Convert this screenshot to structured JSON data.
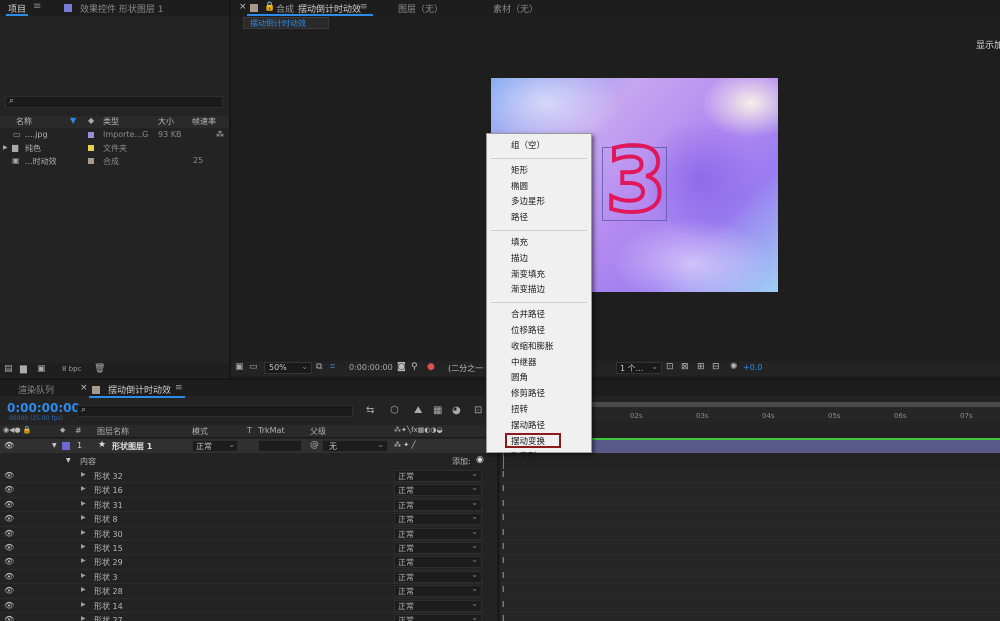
{
  "project_panel": {
    "tab_label": "项目",
    "effect_tab_label": "效果控件 形状图层 1",
    "search_placeholder": "",
    "columns": {
      "name": "名称",
      "type": "类型",
      "size": "大小",
      "framerate": "帧速率"
    },
    "items": [
      {
        "name": "....jpg",
        "type": "Importe...G",
        "size": "93 KB",
        "framerate": "",
        "color": "#9b8ed6"
      },
      {
        "name": "纯色",
        "type": "文件夹",
        "size": "",
        "framerate": "",
        "color": "#e6cf52"
      },
      {
        "name": "...时动效",
        "type": "合成",
        "size": "",
        "framerate": "25",
        "color": "#a89a8a"
      }
    ],
    "bpc_label": "8 bpc"
  },
  "comp_viewer": {
    "tab_prefix": "合成",
    "comp_name": "摆动倒计时动效",
    "layer_tab": "图层（无）",
    "footage_tab": "素材（无）",
    "sub_tab": "摆动倒计时动效",
    "show_label": "显示加",
    "zoom": "50%",
    "timecode": "0:00:00:00",
    "resolution": "(二分之一",
    "views": "1 个...",
    "exposure": "+0.0",
    "digit": "3"
  },
  "context_menu": {
    "items": [
      {
        "label": "组（空）",
        "group": 0
      },
      {
        "label": "矩形",
        "group": 1
      },
      {
        "label": "椭圆",
        "group": 1
      },
      {
        "label": "多边星形",
        "group": 1
      },
      {
        "label": "路径",
        "group": 1
      },
      {
        "label": "填充",
        "group": 2
      },
      {
        "label": "描边",
        "group": 2
      },
      {
        "label": "渐变填充",
        "group": 2
      },
      {
        "label": "渐变描边",
        "group": 2
      },
      {
        "label": "合并路径",
        "group": 3
      },
      {
        "label": "位移路径",
        "group": 3
      },
      {
        "label": "收缩和膨胀",
        "group": 3
      },
      {
        "label": "中继器",
        "group": 3
      },
      {
        "label": "圆角",
        "group": 3
      },
      {
        "label": "修剪路径",
        "group": 3
      },
      {
        "label": "扭转",
        "group": 3
      },
      {
        "label": "摆动路径",
        "group": 3
      },
      {
        "label": "摆动变换",
        "group": 3,
        "highlighted": true
      },
      {
        "label": "Z 字形",
        "group": 3
      }
    ],
    "highlight_color": "#8b1a1a"
  },
  "timeline": {
    "render_queue_tab": "渲染队列",
    "comp_tab": "摆动倒计时动效",
    "timecode": "0:00:00:00",
    "timecode_sub": "00000 (25.00 fps)",
    "headers": {
      "hash": "#",
      "layer_name": "图层名称",
      "mode": "模式",
      "t": "T",
      "trkmat": "TrkMat",
      "parent": "父级"
    },
    "layer": {
      "index": "1",
      "name": "形状图层 1",
      "mode": "正常",
      "parent": "无"
    },
    "contents_label": "内容",
    "add_label": "添加:",
    "shapes": [
      {
        "name": "形状 32",
        "mode": "正常"
      },
      {
        "name": "形状 16",
        "mode": "正常"
      },
      {
        "name": "形状 31",
        "mode": "正常"
      },
      {
        "name": "形状 8",
        "mode": "正常"
      },
      {
        "name": "形状 30",
        "mode": "正常"
      },
      {
        "name": "形状 15",
        "mode": "正常"
      },
      {
        "name": "形状 29",
        "mode": "正常"
      },
      {
        "name": "形状 3",
        "mode": "正常"
      },
      {
        "name": "形状 28",
        "mode": "正常"
      },
      {
        "name": "形状 14",
        "mode": "正常"
      },
      {
        "name": "形状 27",
        "mode": "正常"
      }
    ],
    "ruler_ticks": [
      "02s",
      "03s",
      "04s",
      "05s",
      "06s",
      "07s"
    ],
    "accent": "#2d8ceb",
    "layer_bar_color": "#5a5a8a",
    "work_area_color": "#3ec83e"
  }
}
